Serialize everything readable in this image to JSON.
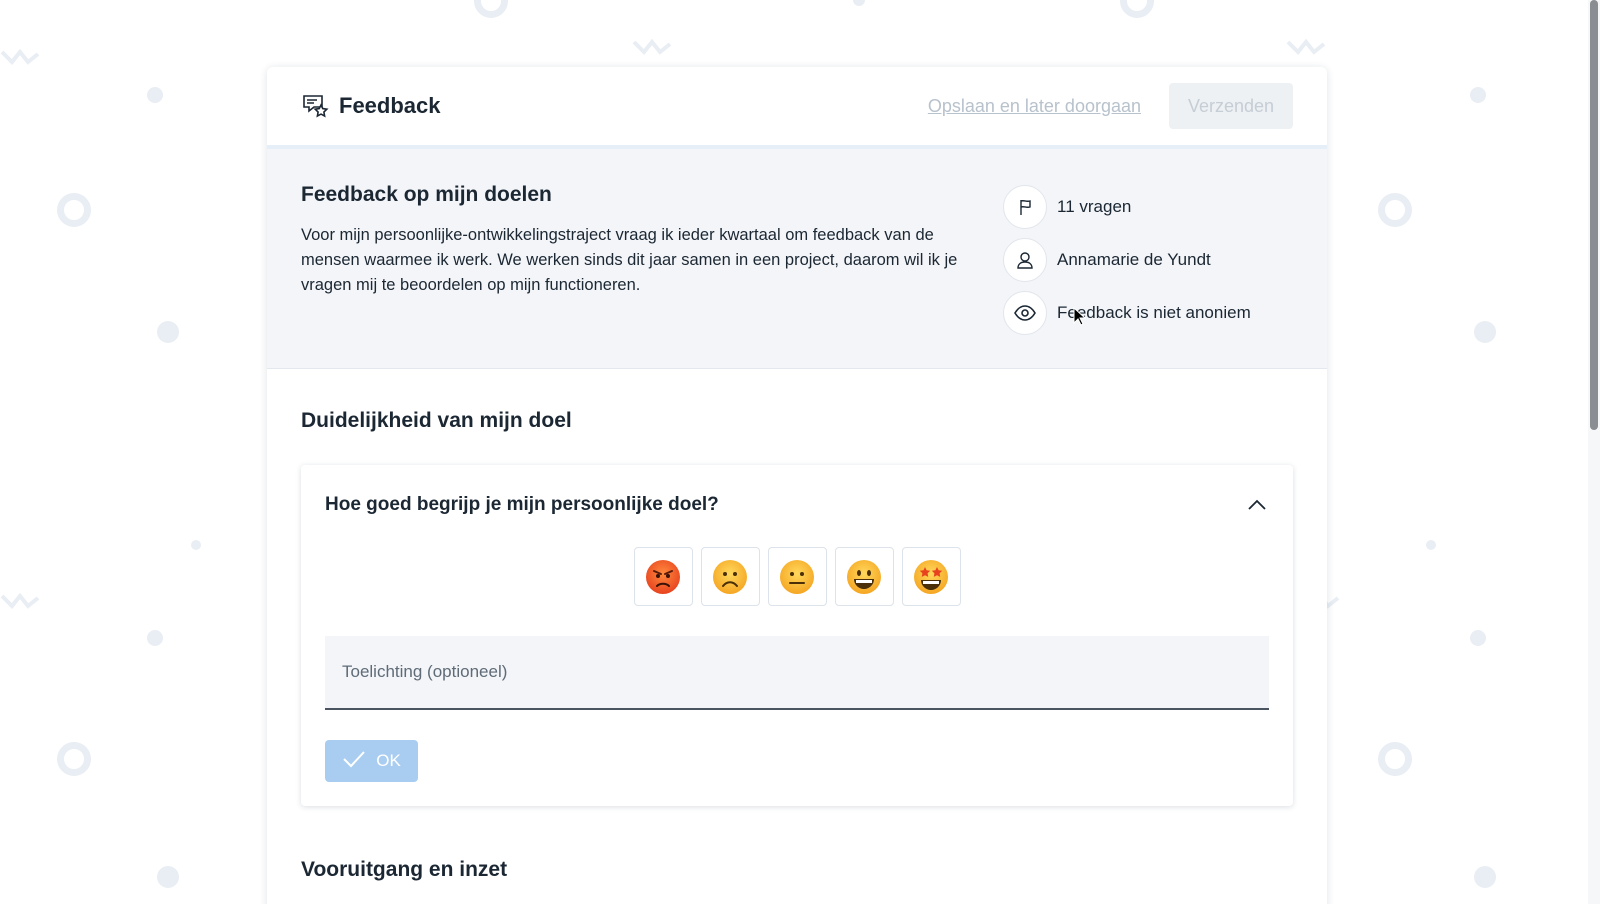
{
  "header": {
    "title": "Feedback",
    "save_label": "Opslaan en later doorgaan",
    "send_label": "Verzenden"
  },
  "intro": {
    "heading": "Feedback op mijn doelen",
    "description": "Voor mijn persoonlijke-ontwikkelingstraject vraag ik ieder kwartaal om feedback van de mensen waarmee ik werk. We werken sinds dit jaar samen in een project, daarom wil ik je vragen mij te beoordelen op mijn functioneren.",
    "meta": [
      {
        "icon": "flag-icon",
        "text": "11 vragen"
      },
      {
        "icon": "user-icon",
        "text": "Annamarie de Yundt"
      },
      {
        "icon": "eye-icon",
        "text": "Feedback is niet anoniem"
      }
    ]
  },
  "sections": [
    {
      "heading": "Duidelijkheid van mijn doel",
      "question": {
        "title": "Hoe goed begrijp je mijn persoonlijke doel?",
        "ratings": [
          "😡",
          "☹️",
          "😐",
          "😀",
          "🤩"
        ],
        "comment_placeholder": "Toelichting (optioneel)",
        "comment_value": "",
        "ok_label": "OK"
      }
    },
    {
      "heading": "Vooruitgang en inzet"
    }
  ],
  "colors": {
    "ok_button": "#a9cdf1",
    "intro_bg": "#f3f5f8",
    "decoration": "#e9eef4"
  }
}
